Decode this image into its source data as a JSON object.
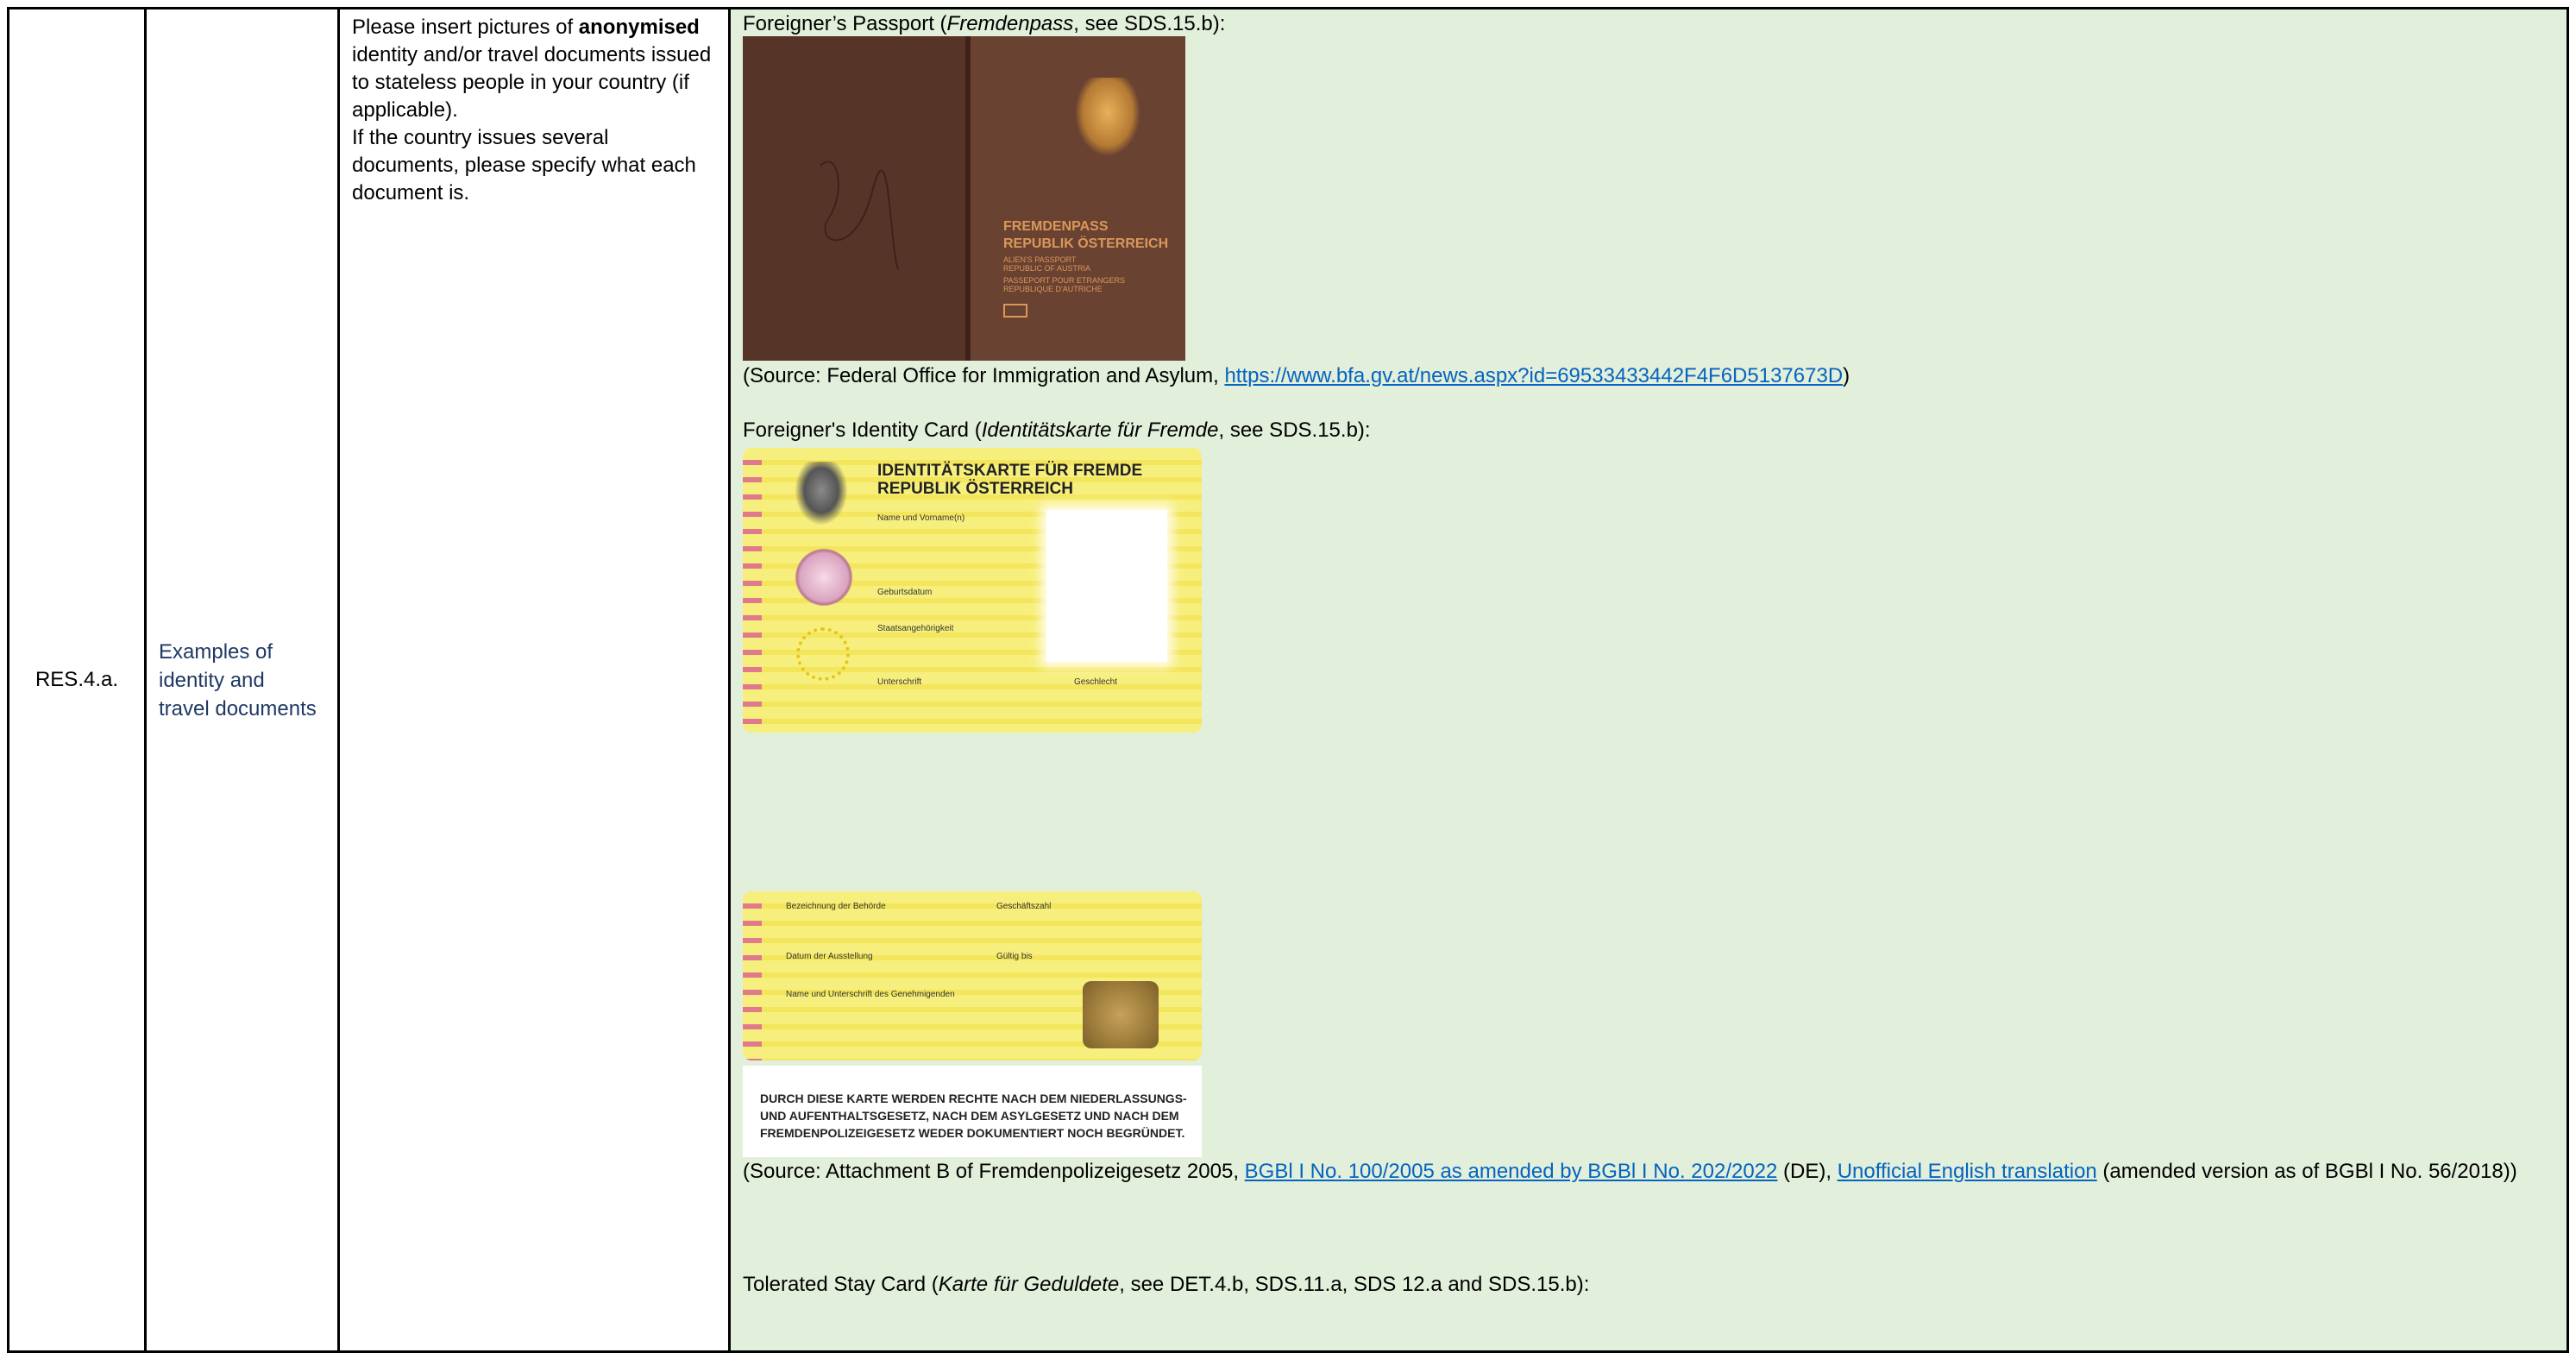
{
  "row": {
    "id": "RES.4.a.",
    "title_lines": [
      "Examples of",
      "identity and",
      "travel documents"
    ],
    "instructions": {
      "part1_before_bold": "Please insert pictures of ",
      "part1_bold": "anonymised",
      "part1_after": " identity and/or travel documents issued to stateless people in your country (if applicable).",
      "part2": "If the country issues several documents, please specify what each document is."
    }
  },
  "answer": {
    "passport": {
      "heading_pre": "Foreigner’s Passport (",
      "heading_italic": "Fremdenpass",
      "heading_post": ", see SDS.15.b):",
      "image_text": {
        "line1": "FREMDENPASS",
        "line2": "REPUBLIK ÖSTERREICH",
        "small1": "ALIEN'S PASSPORT",
        "small2": "REPUBLIC OF AUSTRIA",
        "small3": "PASSEPORT POUR ETRANGERS",
        "small4": "REPUBLIQUE D'AUTRICHE"
      },
      "source_pre": "(Source: Federal Office for Immigration and Asylum,  ",
      "source_link": "https://www.bfa.gv.at/news.aspx?id=69533433442F4F6D5137673D",
      "source_post": ")"
    },
    "id_card": {
      "heading_pre": "Foreigner's Identity Card (",
      "heading_italic": "Identitätskarte für Fremde",
      "heading_post": ", see SDS.15.b):",
      "card_title1": "IDENTITÄTSKARTE FÜR FREMDE",
      "card_title2": "REPUBLIK ÖSTERREICH",
      "front_labels": [
        "Name und Vorname(n)",
        "Geburtsdatum",
        "Staatsangehörigkeit",
        "Unterschrift",
        "Geschlecht"
      ],
      "back_labels": [
        "Bezeichnung der Behörde",
        "Geschäftszahl",
        "Datum der Ausstellung",
        "Gültig bis",
        "Name und Unterschrift des Genehmigenden"
      ],
      "warning_lines": [
        "DURCH DIESE KARTE WERDEN RECHTE NACH DEM NIEDERLASSUNGS-",
        "UND AUFENTHALTSGESETZ, NACH DEM ASYLGESETZ UND NACH DEM",
        "FREMDENPOLIZEIGESETZ WEDER DOKUMENTIERT NOCH BEGRÜNDET."
      ],
      "source_pre": "(Source: Attachment B of  Fremdenpolizeigesetz 2005, ",
      "source_link1": "BGBl I No. 100/2005 as amended by BGBl I No. 202/2022",
      "source_mid": " (DE), ",
      "source_link2": "Unofficial English translation",
      "source_post": " (amended version as of BGBl I No. 56/2018))"
    },
    "tolerated": {
      "heading_pre": "Tolerated Stay Card (",
      "heading_italic": "Karte für Geduldete",
      "heading_post": ", see DET.4.b, SDS.11.a, SDS 12.a and SDS.15.b):"
    }
  }
}
